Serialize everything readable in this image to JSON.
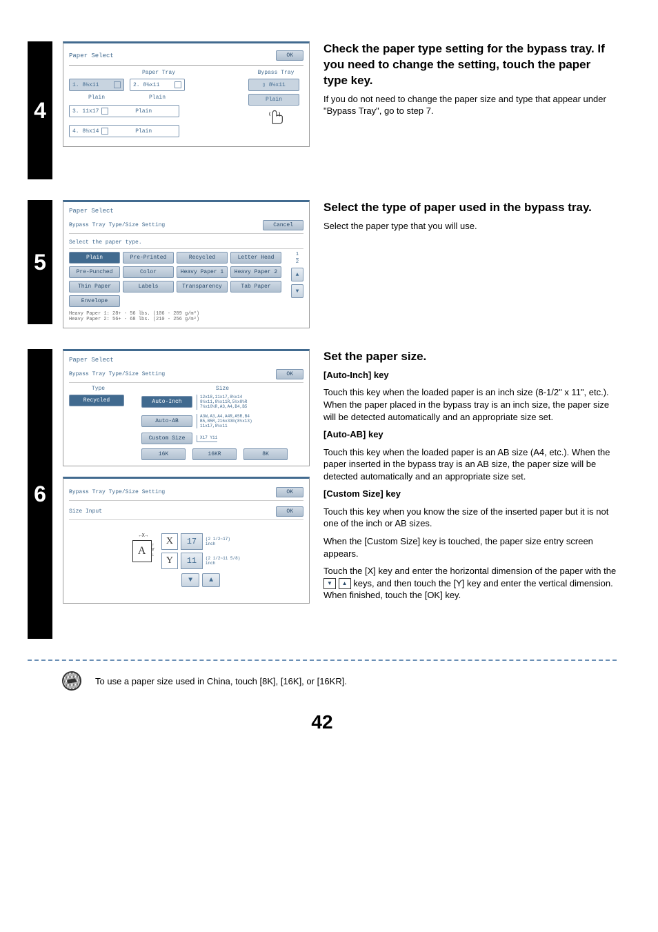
{
  "page_number": "42",
  "step4": {
    "num": "4",
    "screen": {
      "title": "Paper Select",
      "ok": "OK",
      "paper_tray_label": "Paper Tray",
      "bypass_tray_label": "Bypass Tray",
      "trays": [
        {
          "label": "1. 8½x11",
          "type": "Plain"
        },
        {
          "label": "2. 8½x11",
          "type": "Plain"
        },
        {
          "label": "3. 11x17",
          "type": "Plain"
        },
        {
          "label": "4. 8½x14",
          "type": "Plain"
        }
      ],
      "bypass_size": "8½x11",
      "bypass_type": "Plain"
    },
    "heading": "Check the paper type setting for the bypass tray. If you need to change the setting, touch the paper type key.",
    "body": "If you do not need to change the paper size and type that appear under \"Bypass Tray\", go to step 7."
  },
  "step5": {
    "num": "5",
    "screen": {
      "title": "Paper Select",
      "sub": "Bypass Tray Type/Size Setting",
      "cancel": "Cancel",
      "prompt": "Select the paper type.",
      "pager_top": "1",
      "pager_bot": "2",
      "types": [
        "Plain",
        "Pre-Printed",
        "Recycled",
        "Letter Head",
        "Pre-Punched",
        "Color",
        "Heavy Paper 1",
        "Heavy Paper 2",
        "Thin Paper",
        "Labels",
        "Transparency",
        "Tab Paper",
        "Envelope"
      ],
      "note1": "Heavy Paper 1: 28+ - 56 lbs. (106 - 209 g/m²)",
      "note2": "Heavy Paper 2: 56+ - 68 lbs. (210 - 256 g/m²)"
    },
    "heading": "Select the type of paper used in the bypass tray.",
    "body": "Select the paper type that you will use."
  },
  "step6": {
    "num": "6",
    "screenA": {
      "title": "Paper Select",
      "sub": "Bypass Tray Type/Size Setting",
      "ok": "OK",
      "type_label": "Type",
      "type_value": "Recycled",
      "size_label": "Size",
      "auto_inch": "Auto-Inch",
      "auto_inch_desc": "12x18,11x17,8½x14\n8½x11,8½x11R,5½x8½R\n7¼x10½R,A3,A4,B4,B5",
      "auto_ab": "Auto-AB",
      "auto_ab_desc": "A3W,A3,A4,A4R,A5R,B4\nB5,B5R,216x330(8½x13)\n11x17,8½x11",
      "custom": "Custom Size",
      "custom_desc": "X17 Y11",
      "k16": "16K",
      "k16r": "16KR",
      "k8": "8K"
    },
    "screenB": {
      "sub": "Bypass Tray Type/Size Setting",
      "ok": "OK",
      "size_input": "Size Input",
      "ok2": "OK",
      "x": "X",
      "x_val": "17",
      "x_range": "(2 1/2~17)\ninch",
      "y": "Y",
      "y_val": "11",
      "y_range": "(2 1/2~11 5/8)\ninch"
    },
    "heading": "Set the paper size.",
    "k_auto_inch": "[Auto-Inch] key",
    "p_auto_inch": "Touch this key when the loaded paper is an inch size (8-1/2\" x 11\", etc.). When the paper placed in the bypass tray is an inch size, the paper size will be detected automatically and an appropriate size set.",
    "k_auto_ab": "[Auto-AB] key",
    "p_auto_ab": "Touch this key when the loaded paper is an AB size (A4, etc.). When the paper inserted in the bypass tray is an AB size, the paper size will be detected automatically and an appropriate size set.",
    "k_custom": "[Custom Size] key",
    "p_custom1": "Touch this key when you know the size of the inserted paper but it is not one of the inch or AB sizes.",
    "p_custom2": "When the [Custom Size] key is touched, the paper size entry screen appears.",
    "p_custom3a": "Touch the [X] key and enter the horizontal dimension of the paper with the ",
    "p_custom3b": " keys, and then touch the [Y] key and enter the vertical dimension. When finished, touch the [OK] key."
  },
  "tip": "To use a paper size used in China, touch [8K], [16K], or [16KR]."
}
